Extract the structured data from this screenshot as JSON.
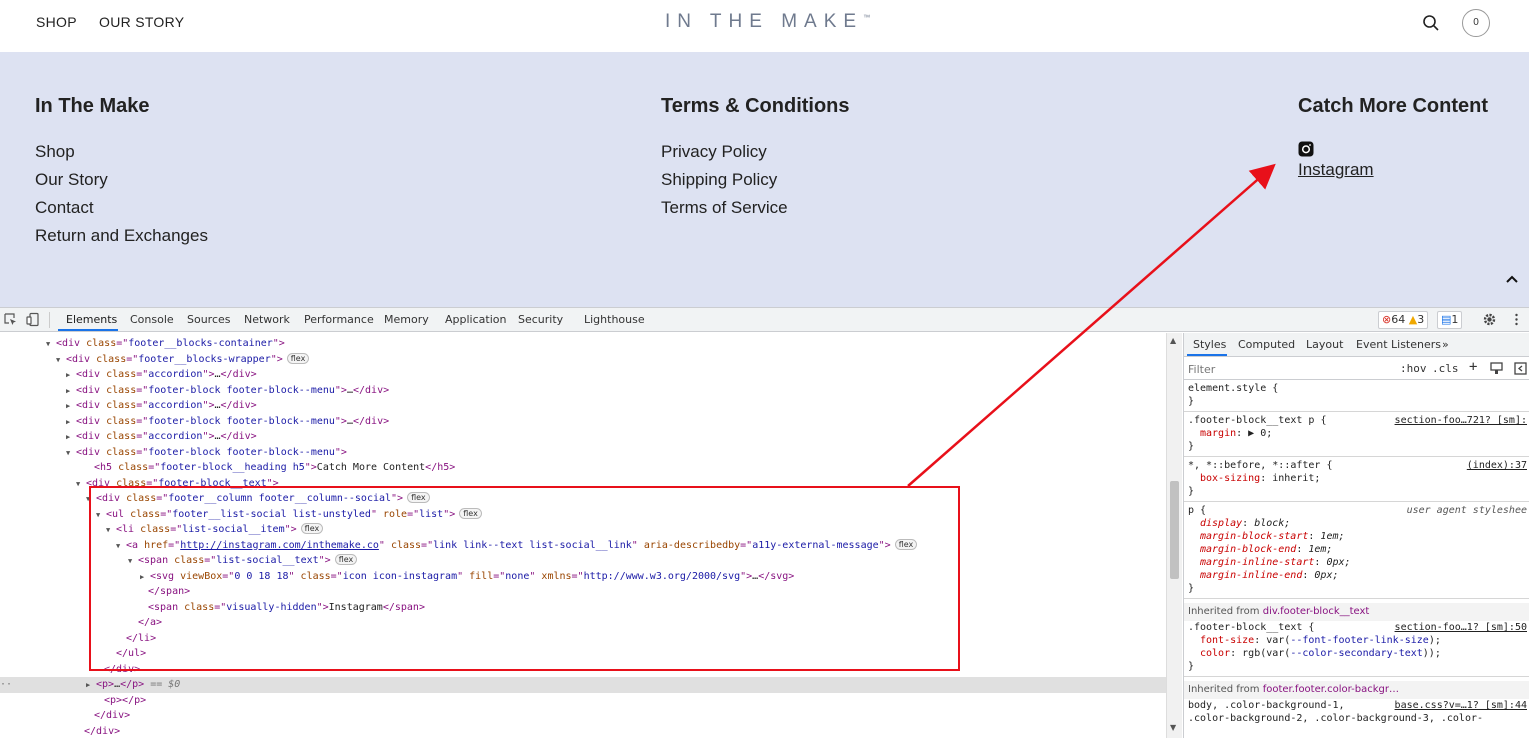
{
  "header": {
    "nav": [
      "SHOP",
      "OUR STORY"
    ],
    "logo": "IN THE MAKE",
    "logo_mark": "™",
    "cart_count": "0"
  },
  "footer": {
    "columns": [
      {
        "heading": "In The Make",
        "links": [
          "Shop",
          "Our Story",
          "Contact",
          "Return and Exchanges"
        ]
      },
      {
        "heading": "Terms & Conditions",
        "links": [
          "Privacy Policy",
          "Shipping Policy",
          "Terms of Service"
        ]
      },
      {
        "heading": "Catch More Content",
        "links": [
          "Instagram"
        ]
      }
    ]
  },
  "devtools": {
    "tabs": [
      "Elements",
      "Console",
      "Sources",
      "Network",
      "Performance",
      "Memory",
      "Application",
      "Security",
      "Lighthouse"
    ],
    "more_tabs": "»",
    "errors": "64",
    "warnings": "3",
    "messages": "1",
    "dom_lines": [
      {
        "indent": 56,
        "arrow": "▼",
        "html": "<span class=\"t-tag\">&lt;div </span><span class=\"t-attr\">class</span><span class=\"t-tag\">=\"</span><span class=\"t-val\">footer__blocks-container</span><span class=\"t-tag\">\"&gt;</span>"
      },
      {
        "indent": 66,
        "arrow": "▼",
        "html": "<span class=\"t-tag\">&lt;div </span><span class=\"t-attr\">class</span><span class=\"t-tag\">=\"</span><span class=\"t-val\">footer__blocks-wrapper</span><span class=\"t-tag\">\"&gt;</span>",
        "flex": true
      },
      {
        "indent": 76,
        "arrow": "▶",
        "html": "<span class=\"t-tag\">&lt;div </span><span class=\"t-attr\">class</span><span class=\"t-tag\">=\"</span><span class=\"t-val\">accordion</span><span class=\"t-tag\">\"&gt;</span><span class=\"t-text\">…</span><span class=\"t-tag\">&lt;/div&gt;</span>"
      },
      {
        "indent": 76,
        "arrow": "▶",
        "html": "<span class=\"t-tag\">&lt;div </span><span class=\"t-attr\">class</span><span class=\"t-tag\">=\"</span><span class=\"t-val\">footer-block footer-block--menu</span><span class=\"t-tag\">\"&gt;</span><span class=\"t-text\">…</span><span class=\"t-tag\">&lt;/div&gt;</span>"
      },
      {
        "indent": 76,
        "arrow": "▶",
        "html": "<span class=\"t-tag\">&lt;div </span><span class=\"t-attr\">class</span><span class=\"t-tag\">=\"</span><span class=\"t-val\">accordion</span><span class=\"t-tag\">\"&gt;</span><span class=\"t-text\">…</span><span class=\"t-tag\">&lt;/div&gt;</span>"
      },
      {
        "indent": 76,
        "arrow": "▶",
        "html": "<span class=\"t-tag\">&lt;div </span><span class=\"t-attr\">class</span><span class=\"t-tag\">=\"</span><span class=\"t-val\">footer-block footer-block--menu</span><span class=\"t-tag\">\"&gt;</span><span class=\"t-text\">…</span><span class=\"t-tag\">&lt;/div&gt;</span>"
      },
      {
        "indent": 76,
        "arrow": "▶",
        "html": "<span class=\"t-tag\">&lt;div </span><span class=\"t-attr\">class</span><span class=\"t-tag\">=\"</span><span class=\"t-val\">accordion</span><span class=\"t-tag\">\"&gt;</span><span class=\"t-text\">…</span><span class=\"t-tag\">&lt;/div&gt;</span>"
      },
      {
        "indent": 76,
        "arrow": "▼",
        "html": "<span class=\"t-tag\">&lt;div </span><span class=\"t-attr\">class</span><span class=\"t-tag\">=\"</span><span class=\"t-val\">footer-block footer-block--menu</span><span class=\"t-tag\">\"&gt;</span>"
      },
      {
        "indent": 94,
        "arrow": "",
        "html": "<span class=\"t-tag\">&lt;h5 </span><span class=\"t-attr\">class</span><span class=\"t-tag\">=\"</span><span class=\"t-val\">footer-block__heading h5</span><span class=\"t-tag\">\"&gt;</span><span class=\"t-text\">Catch More Content</span><span class=\"t-tag\">&lt;/h5&gt;</span>"
      },
      {
        "indent": 86,
        "arrow": "▼",
        "html": "<span class=\"t-tag\">&lt;div </span><span class=\"t-attr\">class</span><span class=\"t-tag\">=\"</span><span class=\"t-val\">footer-block__text</span><span class=\"t-tag\">\"&gt;</span>"
      },
      {
        "indent": 96,
        "arrow": "▼",
        "html": "<span class=\"t-tag\">&lt;div </span><span class=\"t-attr\">class</span><span class=\"t-tag\">=\"</span><span class=\"t-val\">footer__column footer__column--social</span><span class=\"t-tag\">\"&gt;</span>",
        "flex": true
      },
      {
        "indent": 106,
        "arrow": "▼",
        "html": "<span class=\"t-tag\">&lt;ul </span><span class=\"t-attr\">class</span><span class=\"t-tag\">=\"</span><span class=\"t-val\">footer__list-social list-unstyled</span><span class=\"t-tag\">\" </span><span class=\"t-attr\">role</span><span class=\"t-tag\">=\"</span><span class=\"t-val\">list</span><span class=\"t-tag\">\"&gt;</span>",
        "flex": true
      },
      {
        "indent": 116,
        "arrow": "▼",
        "html": "<span class=\"t-tag\">&lt;li </span><span class=\"t-attr\">class</span><span class=\"t-tag\">=\"</span><span class=\"t-val\">list-social__item</span><span class=\"t-tag\">\"&gt;</span>",
        "flex": true
      },
      {
        "indent": 126,
        "arrow": "▼",
        "html": "<span class=\"t-tag\">&lt;a </span><span class=\"t-attr\">href</span><span class=\"t-tag\">=\"</span><span class=\"t-link\">http://instagram.com/inthemake.co</span><span class=\"t-tag\">\" </span><span class=\"t-attr\">class</span><span class=\"t-tag\">=\"</span><span class=\"t-val\">link link--text list-social__link</span><span class=\"t-tag\">\" </span><span class=\"t-attr\">aria-describedby</span><span class=\"t-tag\">=\"</span><span class=\"t-val\">a11y-external-message</span><span class=\"t-tag\">\"&gt;</span>",
        "flex": true
      },
      {
        "indent": 138,
        "arrow": "▼",
        "html": "<span class=\"t-tag\">&lt;span </span><span class=\"t-attr\">class</span><span class=\"t-tag\">=\"</span><span class=\"t-val\">list-social__text</span><span class=\"t-tag\">\"&gt;</span>",
        "flex": true
      },
      {
        "indent": 150,
        "arrow": "▶",
        "html": "<span class=\"t-tag\">&lt;svg </span><span class=\"t-attr\">viewBox</span><span class=\"t-tag\">=\"</span><span class=\"t-val\">0 0 18 18</span><span class=\"t-tag\">\" </span><span class=\"t-attr\">class</span><span class=\"t-tag\">=\"</span><span class=\"t-val\">icon icon-instagram</span><span class=\"t-tag\">\" </span><span class=\"t-attr\">fill</span><span class=\"t-tag\">=\"</span><span class=\"t-val\">none</span><span class=\"t-tag\">\" </span><span class=\"t-attr\">xmlns</span><span class=\"t-tag\">=\"</span><span class=\"t-val\">http://www.w3.org/2000/svg</span><span class=\"t-tag\">\"&gt;</span><span class=\"t-text\">…</span><span class=\"t-tag\">&lt;/svg&gt;</span>"
      },
      {
        "indent": 148,
        "arrow": "",
        "html": "<span class=\"t-tag\">&lt;/span&gt;</span>"
      },
      {
        "indent": 148,
        "arrow": "",
        "html": "<span class=\"t-tag\">&lt;span </span><span class=\"t-attr\">class</span><span class=\"t-tag\">=\"</span><span class=\"t-val\">visually-hidden</span><span class=\"t-tag\">\"&gt;</span><span class=\"t-text\">Instagram</span><span class=\"t-tag\">&lt;/span&gt;</span>"
      },
      {
        "indent": 138,
        "arrow": "",
        "html": "<span class=\"t-tag\">&lt;/a&gt;</span>"
      },
      {
        "indent": 126,
        "arrow": "",
        "html": "<span class=\"t-tag\">&lt;/li&gt;</span>"
      },
      {
        "indent": 116,
        "arrow": "",
        "html": "<span class=\"t-tag\">&lt;/ul&gt;</span>"
      },
      {
        "indent": 104,
        "arrow": "",
        "html": "<span class=\"t-tag\">&lt;/div&gt;</span>"
      },
      {
        "indent": 96,
        "arrow": "▶",
        "html": "<span class=\"t-tag\">&lt;p&gt;</span><span class=\"t-text\">…</span><span class=\"t-tag\">&lt;/p&gt;</span><span class=\"t-dim\"> == $0</span>",
        "selected": true
      },
      {
        "indent": 104,
        "arrow": "",
        "html": "<span class=\"t-tag\">&lt;p&gt;&lt;/p&gt;</span>"
      },
      {
        "indent": 94,
        "arrow": "",
        "html": "<span class=\"t-tag\">&lt;/div&gt;</span>"
      },
      {
        "indent": 84,
        "arrow": "",
        "html": "<span class=\"t-tag\">&lt;/div&gt;</span>"
      }
    ],
    "styles": {
      "tabs": [
        "Styles",
        "Computed",
        "Layout",
        "Event Listeners",
        "»"
      ],
      "filter_placeholder": "Filter",
      "hov": ":hov",
      "cls": ".cls",
      "rules": [
        {
          "selector": "element.style {",
          "source": "",
          "props": []
        },
        {
          "selector": ".footer-block__text p {",
          "source": "section-foo…721? [sm]:",
          "props": [
            {
              "name": "margin",
              "value": "▶ 0;"
            }
          ]
        },
        {
          "selector": "*, *::before, *::after {",
          "source": "(index):37",
          "props": [
            {
              "name": "box-sizing",
              "value": "inherit;"
            }
          ]
        },
        {
          "selector": "p {",
          "source_plain": "user agent styleshee",
          "italic": true,
          "props": [
            {
              "name": "display",
              "value": "block;"
            },
            {
              "name": "margin-block-start",
              "value": "1em;"
            },
            {
              "name": "margin-block-end",
              "value": "1em;"
            },
            {
              "name": "margin-inline-start",
              "value": "0px;"
            },
            {
              "name": "margin-inline-end",
              "value": "0px;"
            }
          ]
        },
        {
          "inherited": "Inherited from ",
          "inherited_sel": "div.footer-block__text"
        },
        {
          "selector": ".footer-block__text {",
          "source": "section-foo…1? [sm]:50",
          "props": [
            {
              "name": "font-size",
              "value": "var(--font-footer-link-size);"
            },
            {
              "name": "color",
              "value": "rgb(var(--color-secondary-text));"
            }
          ]
        },
        {
          "inherited": "Inherited from ",
          "inherited_sel": "footer.footer.color-backgr…"
        },
        {
          "selector": "body, .color-background-1,",
          "source": "base.css?v=…1? [sm]:44",
          "props": []
        },
        {
          "selector": ".color-background-2, .color-background-3, .color-",
          "source": "",
          "props": []
        }
      ]
    }
  },
  "colors": {
    "footer_bg": "#dde2f2",
    "annotation_red": "#e8101a",
    "devtools_accent": "#1a73e8"
  }
}
